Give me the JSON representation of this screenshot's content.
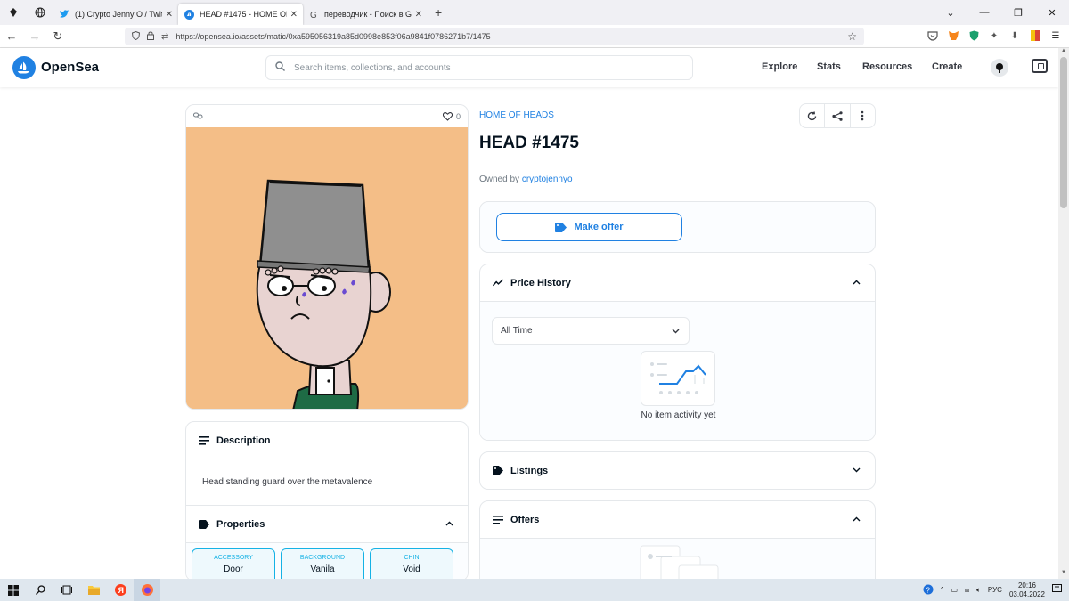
{
  "browser": {
    "tabs": [
      {
        "label": "(1) Crypto Jenny O / Twitter",
        "icon": "twitter-bird-icon"
      },
      {
        "label": "HEAD #1475 - HOME OF HEADS",
        "icon": "opensea-icon",
        "active": true
      },
      {
        "label": "переводчик - Поиск в Google",
        "icon": "google-icon"
      }
    ],
    "url": "https://opensea.io/assets/matic/0xa595056319a85d0998e853f06a9841f0786271b7/1475"
  },
  "header": {
    "brand": "OpenSea",
    "search_placeholder": "Search items, collections, and accounts",
    "nav": [
      "Explore",
      "Stats",
      "Resources",
      "Create"
    ],
    "accent": "#2081e2"
  },
  "asset": {
    "favorites_count": "0",
    "collection": "HOME OF HEADS",
    "title": "HEAD #1475",
    "owned_by_label": "Owned by",
    "owner": "cryptojennyo",
    "background_color": "#f4be87"
  },
  "description": {
    "heading": "Description",
    "text": "Head standing guard over the metavalence"
  },
  "properties": {
    "heading": "Properties",
    "items": [
      {
        "type": "ACCESSORY",
        "value": "Door"
      },
      {
        "type": "BACKGROUND",
        "value": "Vanila"
      },
      {
        "type": "CHIN",
        "value": "Void"
      }
    ]
  },
  "offer": {
    "button_label": "Make offer"
  },
  "price_history": {
    "heading": "Price History",
    "range": "All Time",
    "empty_text": "No item activity yet"
  },
  "listings": {
    "heading": "Listings"
  },
  "offers": {
    "heading": "Offers"
  },
  "taskbar": {
    "lang": "РУС",
    "time": "20:16",
    "date": "03.04.2022"
  }
}
